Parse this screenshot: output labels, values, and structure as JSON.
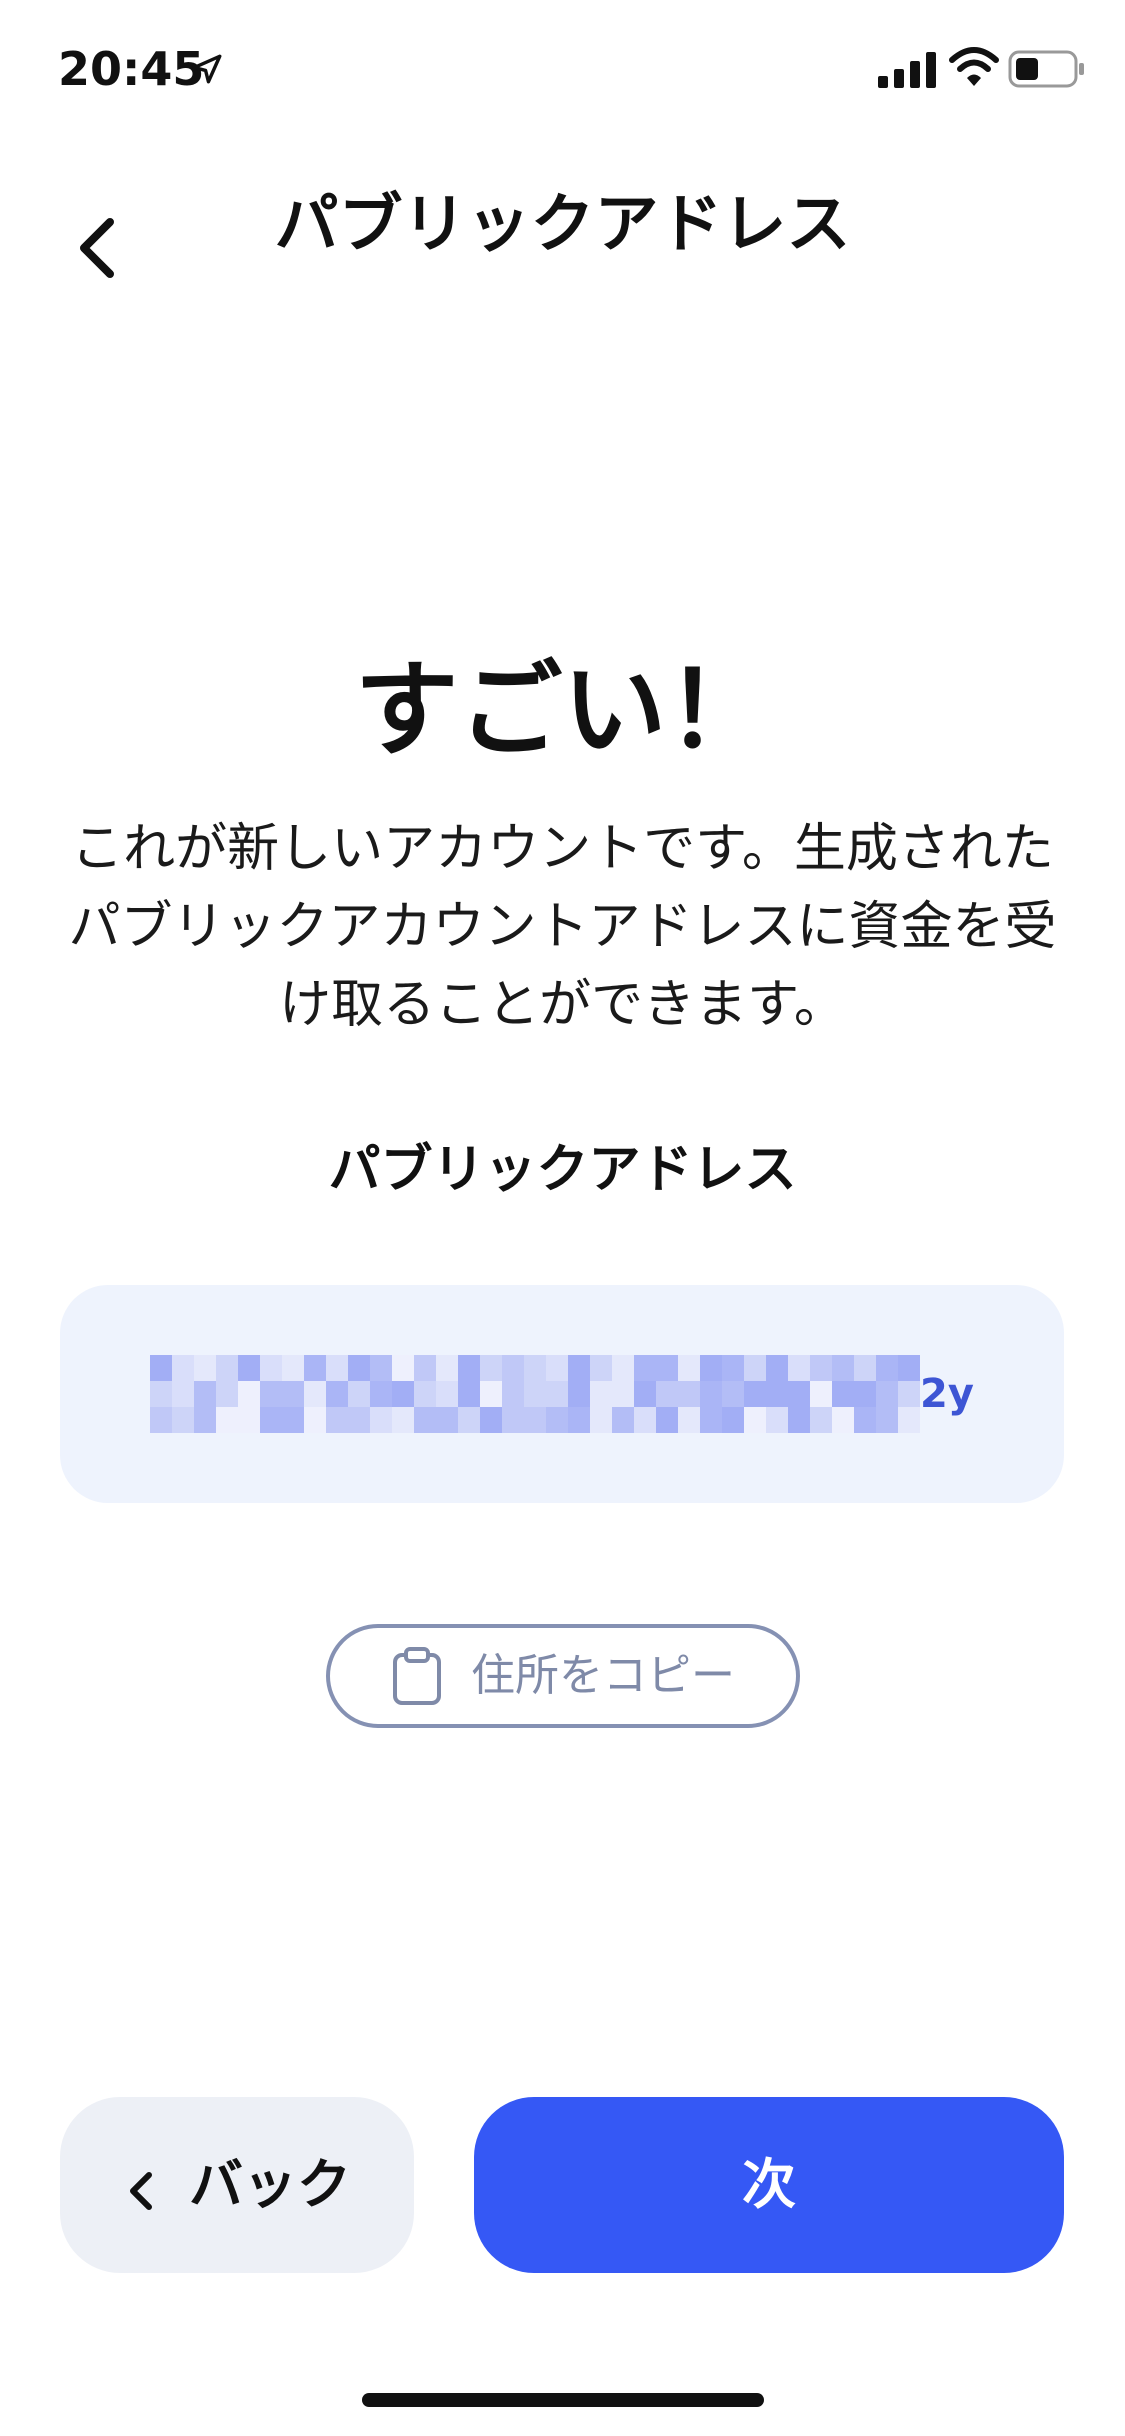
{
  "status_bar": {
    "time": "20:45",
    "icons": [
      "location-arrow-icon",
      "cellular-signal-icon",
      "wifi-icon",
      "battery-icon"
    ]
  },
  "nav": {
    "back_icon": "chevron-left-icon",
    "title": "パブリックアドレス"
  },
  "main": {
    "headline": "すごい！",
    "description": "これが新しいアカウントです。生成されたパブリックアカウントアドレスに資金を受け取ることができます。",
    "section_label": "パブリックアドレス",
    "address": {
      "visible_suffix": "2y",
      "obscured": true
    },
    "copy_button": {
      "icon": "clipboard-icon",
      "label": "住所をコピー"
    }
  },
  "footer": {
    "back_button": {
      "icon": "chevron-left-icon",
      "label": "バック"
    },
    "next_button": {
      "label": "次"
    }
  },
  "colors": {
    "primary": "#3558f5",
    "address_background": "#eef3fd",
    "address_text": "#3d55d4",
    "secondary_button": "#edf0f6",
    "outline": "#8591b3"
  }
}
